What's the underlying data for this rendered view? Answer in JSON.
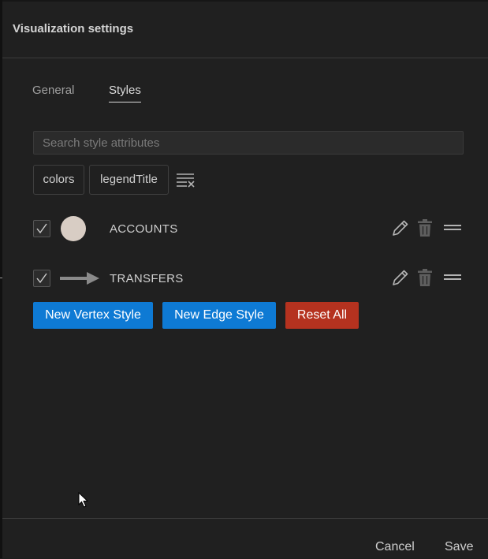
{
  "header": {
    "title": "Visualization settings"
  },
  "tabs": [
    {
      "label": "General",
      "active": false
    },
    {
      "label": "Styles",
      "active": true
    }
  ],
  "search": {
    "placeholder": "Search style attributes",
    "value": ""
  },
  "filter_chips": [
    {
      "label": "colors"
    },
    {
      "label": "legendTitle"
    }
  ],
  "styles": [
    {
      "label": "ACCOUNTS",
      "type": "vertex",
      "checked": true,
      "swatch_color": "#d8cdc4"
    },
    {
      "label": "TRANSFERS",
      "type": "edge",
      "checked": true,
      "swatch_color": "#8a8a8a"
    }
  ],
  "actions": {
    "new_vertex_label": "New Vertex Style",
    "new_edge_label": "New Edge Style",
    "reset_label": "Reset All"
  },
  "footer": {
    "cancel_label": "Cancel",
    "save_label": "Save"
  },
  "colors": {
    "primary_button": "#0e7ad4",
    "danger_button": "#b5321f",
    "background": "#202020"
  }
}
